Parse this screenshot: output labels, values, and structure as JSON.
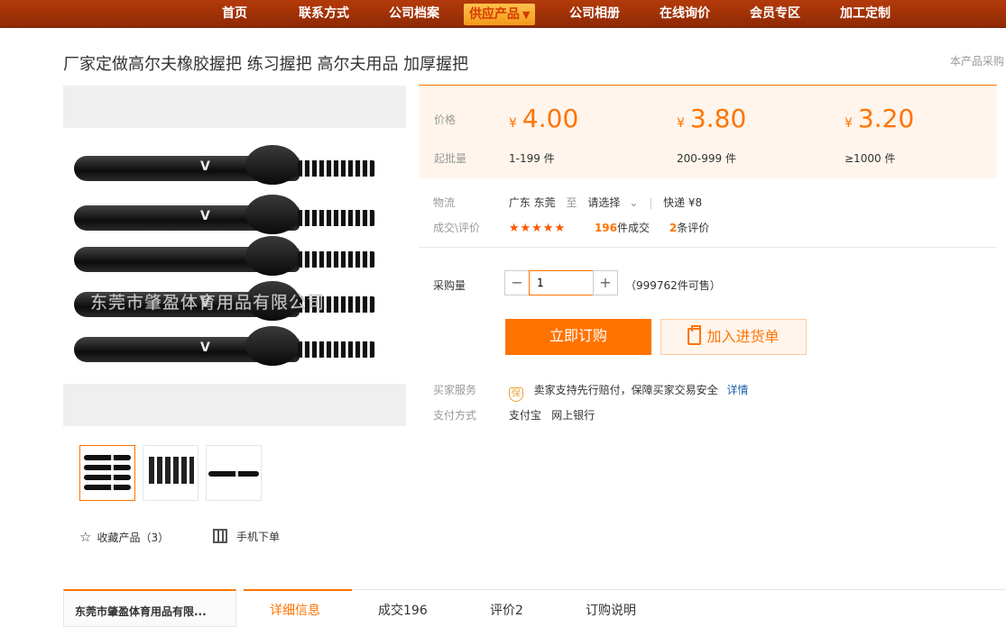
{
  "nav": {
    "items": [
      "首页",
      "联系方式",
      "公司档案",
      "供应产品",
      "公司相册",
      "在线询价",
      "会员专区",
      "加工定制"
    ],
    "active_index": 3,
    "dropdown_glyph": "▼"
  },
  "product": {
    "title": "厂家定做高尔夫橡胶握把 练习握把 高尔夫用品 加厚握把",
    "side_note": "本产品采购",
    "watermark": "东莞市肇盈体育用品有限公司"
  },
  "pricing": {
    "price_label": "价格",
    "moq_label": "起批量",
    "currency": "¥",
    "tiers": [
      {
        "price": "4.00",
        "range": "1-199 件"
      },
      {
        "price": "3.80",
        "range": "200-999 件"
      },
      {
        "price": "3.20",
        "range": "≥1000 件"
      }
    ]
  },
  "logistics": {
    "label": "物流",
    "origin": "广东 东莞",
    "to": "至",
    "destination": "请选择",
    "shipping": "快递 ¥8"
  },
  "deals": {
    "label": "成交\\评价",
    "stars": "★★★★★",
    "sold_count": "196",
    "sold_suffix": "件成交",
    "review_count": "2",
    "review_suffix": "条评价"
  },
  "purchase": {
    "qty_label": "采购量",
    "minus": "−",
    "plus": "+",
    "qty_value": "1",
    "stock": "（999762件可售）",
    "buy_now": "立即订购",
    "add_cart": "加入进货单"
  },
  "service": {
    "label": "买家服务",
    "badge": "保",
    "text": "卖家支持先行赔付，保障买家交易安全",
    "detail_link": "详情"
  },
  "payment": {
    "label": "支付方式",
    "methods": "支付宝   网上银行"
  },
  "actions": {
    "favorite": "收藏产品（3）",
    "mobile_order": "手机下单"
  },
  "bottom": {
    "shop_name": "东莞市肇盈体育用品有限...",
    "tabs": [
      "详细信息",
      "成交196",
      "评价2",
      "订购说明"
    ]
  },
  "colors": {
    "accent": "#ff7300",
    "nav_bg": "#a33408"
  }
}
